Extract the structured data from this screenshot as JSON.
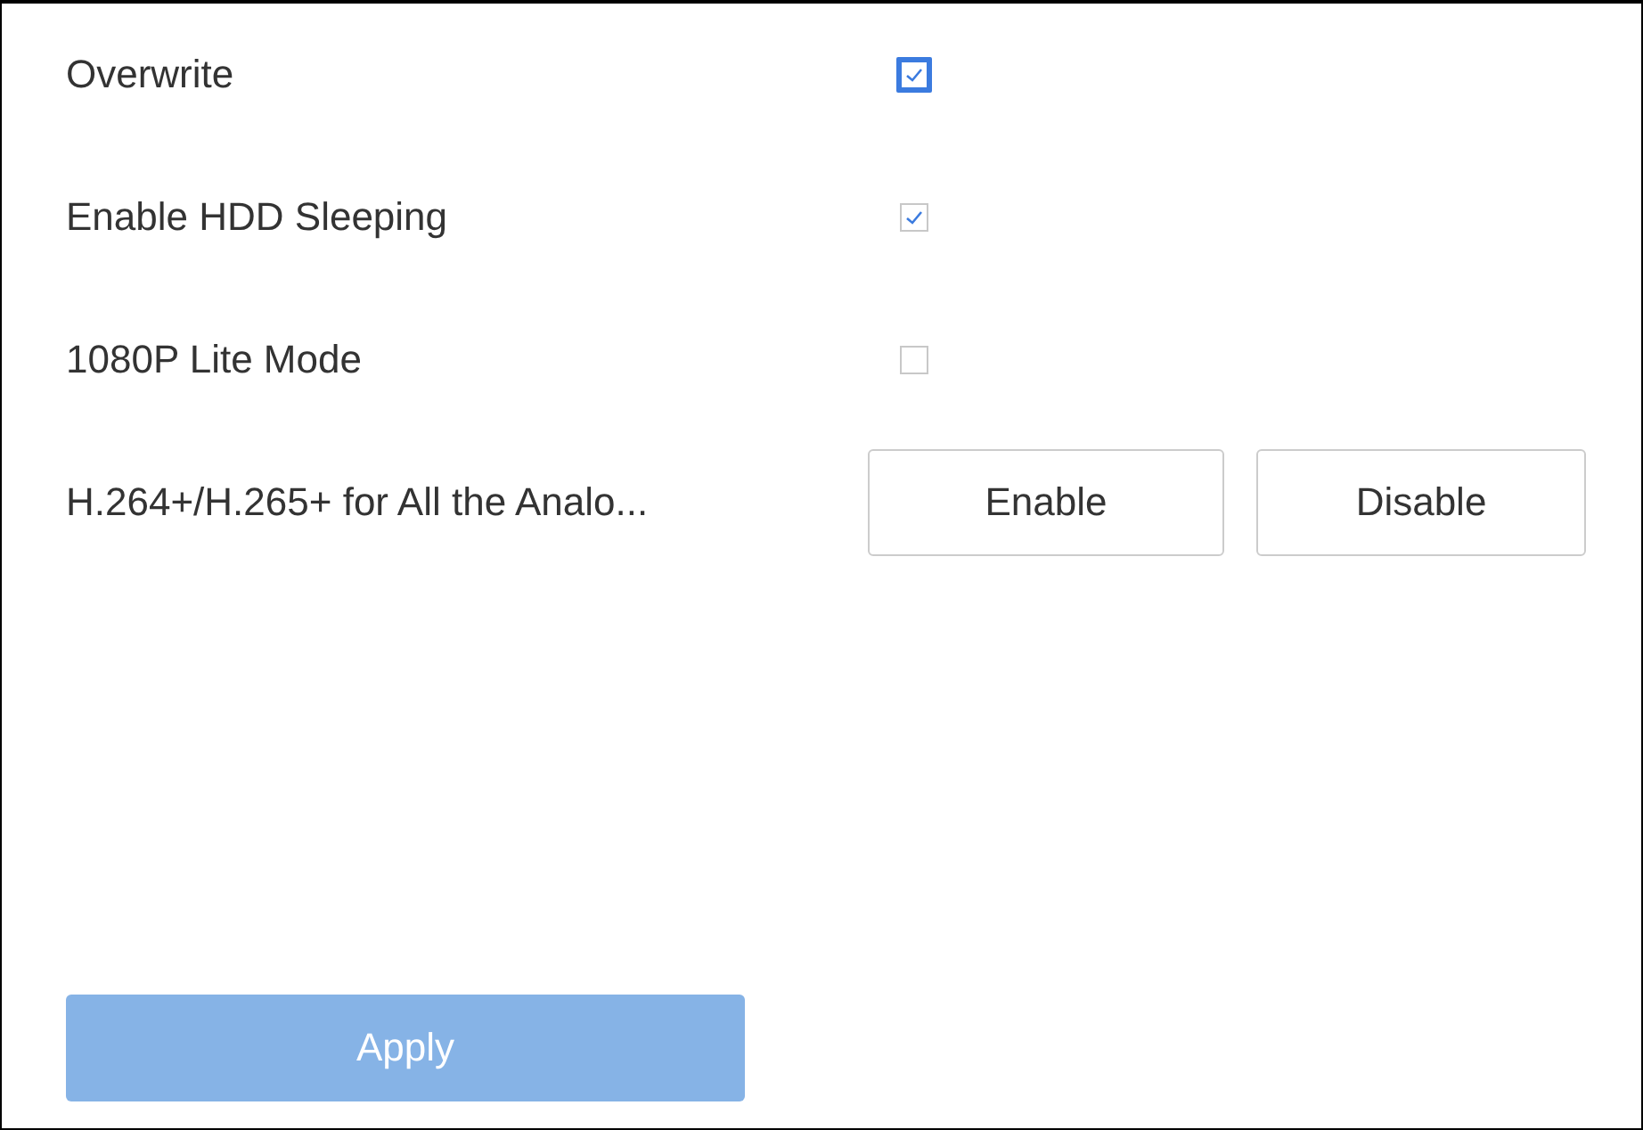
{
  "settings": [
    {
      "kind": "checkbox",
      "label": "Overwrite",
      "checked": true,
      "focused": true
    },
    {
      "kind": "checkbox",
      "label": "Enable HDD Sleeping",
      "checked": true,
      "focused": false
    },
    {
      "kind": "checkbox",
      "label": "1080P Lite Mode",
      "checked": false,
      "focused": false
    },
    {
      "kind": "buttons",
      "label": "H.264+/H.265+ for All the Analo...",
      "buttons": [
        "Enable",
        "Disable"
      ]
    }
  ],
  "apply_button": {
    "label": "Apply",
    "disabled": true
  }
}
